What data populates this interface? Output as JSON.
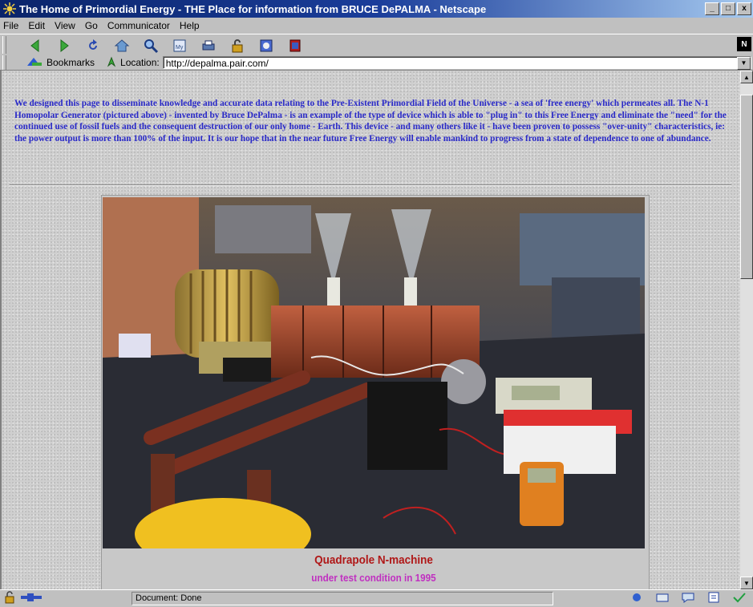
{
  "window": {
    "title": "The Home of Primordial Energy - THE Place for information from BRUCE DePALMA - Netscape",
    "min": "_",
    "max": "□",
    "close": "x"
  },
  "menu": [
    "File",
    "Edit",
    "View",
    "Go",
    "Communicator",
    "Help"
  ],
  "toolbar": {
    "icons": [
      "back-icon",
      "forward-icon",
      "reload-icon",
      "home-icon",
      "search-icon",
      "my-netscape-icon",
      "print-icon",
      "security-icon",
      "shop-icon",
      "stop-icon"
    ],
    "logo": "N"
  },
  "location": {
    "bookmarks_label": "Bookmarks",
    "location_label": "Location:",
    "url": "http://depalma.pair.com/"
  },
  "content": {
    "intro": "We designed this page to disseminate knowledge and accurate data relating to the Pre-Existent Primordial Field of the Universe - a sea of 'free energy' which permeates all.  The N-1 Homopolar Generator (pictured above) - invented by Bruce DePalma - is an example of the type of device which is able to \"plug in\" to this Free Energy and eliminate the \"need\" for the continued use of fossil fuels and the consequent destruction of our only home - Earth.  This device - and many others like it - have been proven to possess \"over-unity\" characteristics, ie: the power output is more than 100% of the input.  It is our hope that in the near future Free Energy will enable mankind to progress from a state of dependence to one of abundance.",
    "caption_title": "Quadrapole N-machine",
    "caption_sub": "under test condition in 1995"
  },
  "status": {
    "text": "Document: Done"
  },
  "colors": {
    "intro_text": "#2a2ac8",
    "caption_title": "#b01818",
    "caption_sub": "#c030c0",
    "titlebar": "#0a246a"
  }
}
